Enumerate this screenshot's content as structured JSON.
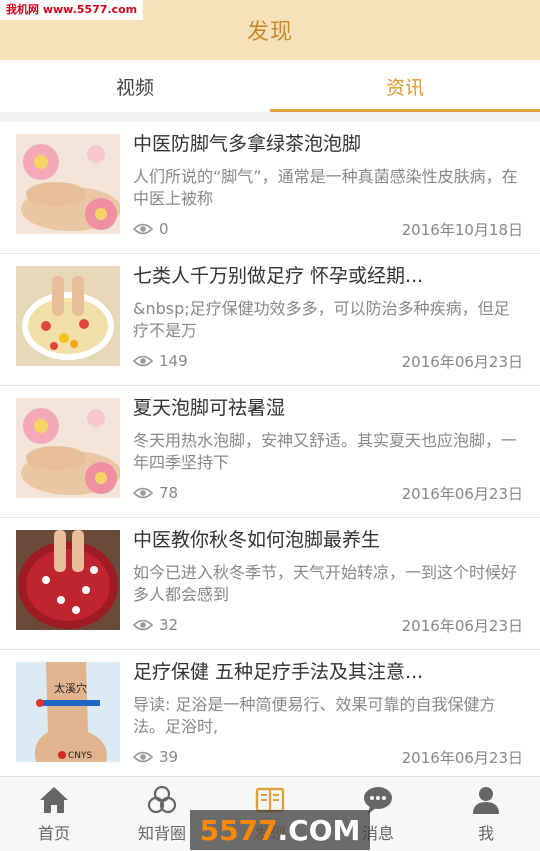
{
  "watermark_top": "我机网 www.5577.com",
  "watermark_bottom": {
    "part1": "5577",
    "part2": ".COM"
  },
  "header": {
    "title": "发现"
  },
  "tabs": [
    {
      "label": "视频",
      "active": false
    },
    {
      "label": "资讯",
      "active": true
    }
  ],
  "articles": [
    {
      "title": "中医防脚气多拿绿茶泡泡脚",
      "desc": "人们所说的“脚气”，通常是一种真菌感染性皮肤病，在中医上被称",
      "views": "0",
      "date": "2016年10月18日",
      "thumb": "flowers-feet"
    },
    {
      "title": "七类人千万别做足疗 怀孕或经期...",
      "desc": "&nbsp;足疗保健功效多多，可以防治多种疾病，但足疗不是万",
      "views": "149",
      "date": "2016年06月23日",
      "thumb": "petal-bowl"
    },
    {
      "title": "夏天泡脚可祛暑湿",
      "desc": "冬天用热水泡脚，安神又舒适。其实夏天也应泡脚，一年四季坚持下",
      "views": "78",
      "date": "2016年06月23日",
      "thumb": "flowers-feet"
    },
    {
      "title": "中医教你秋冬如何泡脚最养生",
      "desc": "如今已进入秋冬季节，天气开始转凉，一到这个时候好多人都会感到",
      "views": "32",
      "date": "2016年06月23日",
      "thumb": "red-bowl"
    },
    {
      "title": "足疗保健 五种足疗手法及其注意...",
      "desc": "导读: 足浴是一种简便易行、效果可靠的自我保健方法。足浴时,",
      "views": "39",
      "date": "2016年06月23日",
      "thumb": "foot-acupoint",
      "thumb_label": "太溪穴",
      "thumb_logo": "CNYS"
    }
  ],
  "bottom_nav": [
    {
      "label": "首页",
      "icon": "home-icon",
      "active": false
    },
    {
      "label": "知背圈",
      "icon": "circles-icon",
      "active": false
    },
    {
      "label": "发现",
      "icon": "book-icon",
      "active": true
    },
    {
      "label": "消息",
      "icon": "chat-icon",
      "active": false
    },
    {
      "label": "我",
      "icon": "user-icon",
      "active": false
    }
  ],
  "colors": {
    "accent": "#e0a03a",
    "header_bg": "#f7e1bb"
  }
}
